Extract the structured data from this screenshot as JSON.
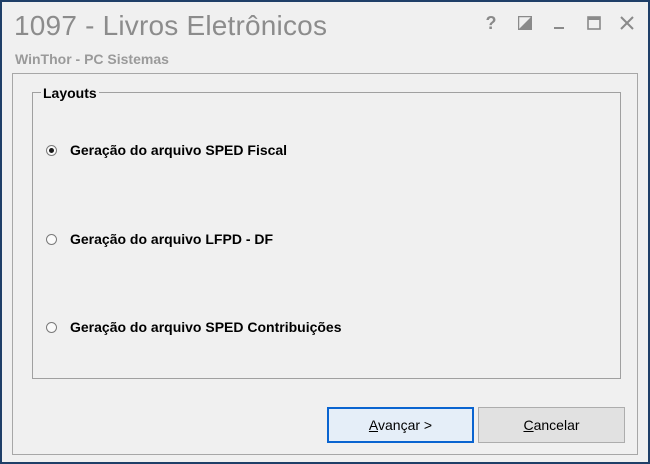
{
  "window": {
    "title": "1097 - Livros Eletrônicos",
    "subtitle": "WinThor - PC Sistemas",
    "controls": {
      "help": "?",
      "minimize": "_"
    }
  },
  "group": {
    "legend": "Layouts",
    "options": [
      {
        "label": "Geração do arquivo SPED Fiscal",
        "checked": true
      },
      {
        "label": "Geração do arquivo LFPD - DF",
        "checked": false
      },
      {
        "label": "Geração do arquivo SPED Contribuições",
        "checked": false
      }
    ]
  },
  "buttons": {
    "next": {
      "mnemonic": "A",
      "rest": "vançar >"
    },
    "cancel": {
      "mnemonic": "C",
      "rest": "ancelar"
    }
  },
  "colors": {
    "window_border": "#1f3f68",
    "title_text": "#8c8c8c",
    "default_button_border": "#0a64d0"
  }
}
